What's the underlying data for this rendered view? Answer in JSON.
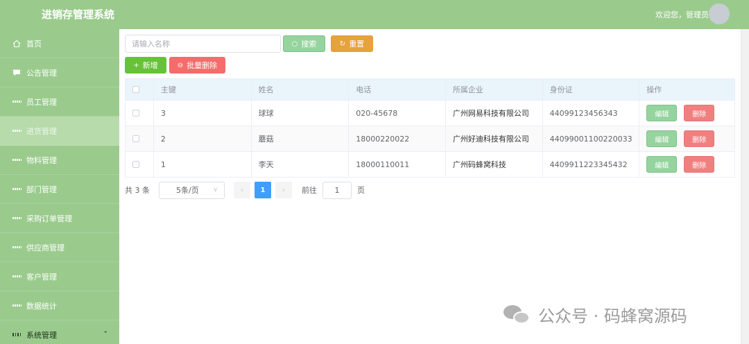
{
  "header": {
    "title": "进销存管理系统",
    "welcome": "欢迎您，管理员"
  },
  "sidebar": {
    "items": [
      {
        "label": "首页",
        "icon": "home-icon"
      },
      {
        "label": "公告管理",
        "icon": "chat-icon"
      },
      {
        "label": "员工管理",
        "icon": "grid-icon"
      },
      {
        "label": "进货管理",
        "icon": "grid-icon",
        "active": true
      },
      {
        "label": "物料管理",
        "icon": "grid-icon"
      },
      {
        "label": "部门管理",
        "icon": "grid-icon"
      },
      {
        "label": "采购订单管理",
        "icon": "grid-icon"
      },
      {
        "label": "供应商管理",
        "icon": "grid-icon"
      },
      {
        "label": "客户管理",
        "icon": "grid-icon"
      },
      {
        "label": "数据统计",
        "icon": "grid-icon"
      },
      {
        "label": "系统管理",
        "icon": "apps-icon"
      }
    ]
  },
  "toolbar": {
    "search_placeholder": "请输入名称",
    "search_label": "搜索",
    "reset_label": "重置",
    "add_label": "新增",
    "batch_delete_label": "批量删除"
  },
  "table": {
    "headers": [
      "主键",
      "姓名",
      "电话",
      "所属企业",
      "身份证",
      "操作"
    ],
    "rows": [
      {
        "id": "3",
        "name": "球球",
        "phone": "020-45678",
        "company": "广州网易科技有限公司",
        "idcard": "44099123456343"
      },
      {
        "id": "2",
        "name": "蘑菇",
        "phone": "18000220022",
        "company": "广州好迪科技有限公司",
        "idcard": "44099001100220033"
      },
      {
        "id": "1",
        "name": "李天",
        "phone": "18000110011",
        "company": "广州码蜂窝科技",
        "idcard": "4409911223345432"
      }
    ],
    "edit_label": "编辑",
    "delete_label": "删除"
  },
  "pager": {
    "total": "共 3 条",
    "page_size": "5条/页",
    "current_page": "1",
    "goto_label": "前往",
    "goto_value": "1",
    "page_suffix": "页"
  },
  "watermark": {
    "text": "公众号 · 码蜂窝源码"
  },
  "colors": {
    "header": "#9acb8d",
    "sidebar_active": "#b7dbab",
    "primary": "#409eff",
    "success": "#67c23a",
    "warning": "#e6a23c",
    "danger": "#f56c6c"
  }
}
